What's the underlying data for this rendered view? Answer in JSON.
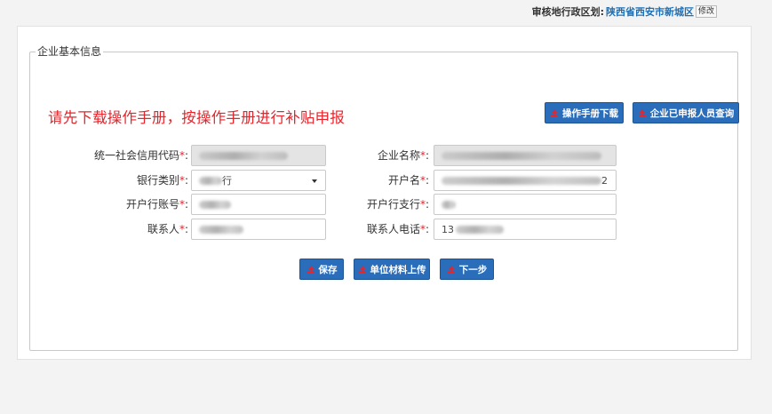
{
  "header": {
    "region_label": "审核地行政区划:",
    "region_value": "陕西省西安市新城区",
    "edit_label": "修改"
  },
  "form": {
    "section_title": "企业基本信息",
    "notice": "请先下载操作手册，按操作手册进行补贴申报",
    "buttons": {
      "manual_download": "操作手册下载",
      "applied_query": "企业已申报人员查询",
      "save": "保存",
      "upload": "单位材料上传",
      "next": "下一步"
    },
    "fields": {
      "credit_code": {
        "label": "统一社会信用代码",
        "value": ""
      },
      "company_name": {
        "label": "企业名称",
        "value": ""
      },
      "bank_type": {
        "label": "银行类别",
        "value": "行"
      },
      "account_name": {
        "label": "开户名",
        "value": "2"
      },
      "bank_account": {
        "label": "开户行账号",
        "value": ""
      },
      "bank_branch": {
        "label": "开户行支行",
        "value": ""
      },
      "contact": {
        "label": "联系人",
        "value": ""
      },
      "contact_phone": {
        "label": "联系人电话",
        "value": "13"
      }
    },
    "required_mark": "*",
    "colon": ":"
  },
  "colors": {
    "accent": "#2a6ebb",
    "notice": "#e8232a",
    "region": "#1c6fb5"
  }
}
